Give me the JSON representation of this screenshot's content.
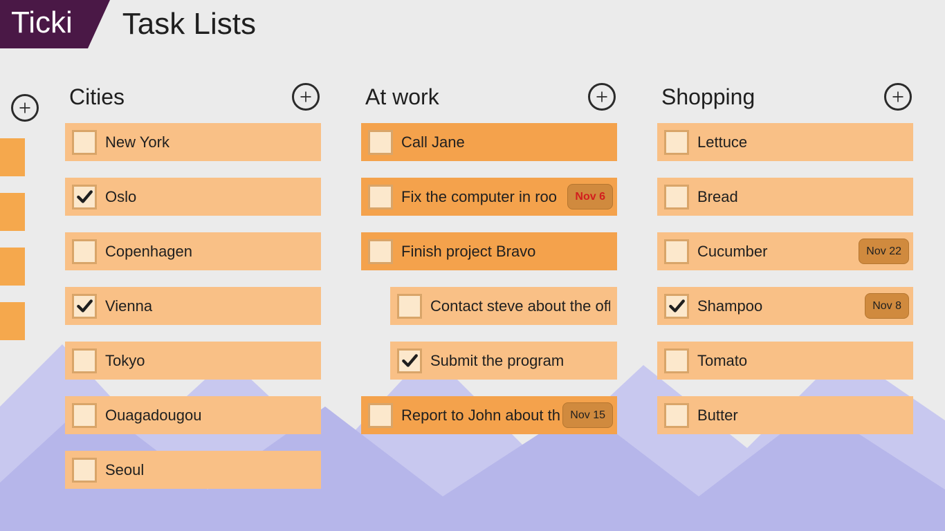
{
  "header": {
    "brand": "Ticki",
    "title": "Task Lists"
  },
  "columns": [
    {
      "title": "Cities",
      "items": [
        {
          "label": "New York",
          "checked": false,
          "dark": false
        },
        {
          "label": "Oslo",
          "checked": true,
          "dark": false
        },
        {
          "label": "Copenhagen",
          "checked": false,
          "dark": false
        },
        {
          "label": "Vienna",
          "checked": true,
          "dark": false
        },
        {
          "label": "Tokyo",
          "checked": false,
          "dark": false
        },
        {
          "label": "Ouagadougou",
          "checked": false,
          "dark": false
        },
        {
          "label": "Seoul",
          "checked": false,
          "dark": false
        }
      ]
    },
    {
      "title": "At work",
      "items": [
        {
          "label": "Call Jane",
          "checked": false,
          "dark": true
        },
        {
          "label": "Fix the computer in roo",
          "checked": false,
          "dark": true,
          "due": "Nov 6",
          "due_alert": true
        },
        {
          "label": "Finish project Bravo",
          "checked": false,
          "dark": true
        },
        {
          "label": "Contact steve about the off",
          "checked": false,
          "dark": false,
          "child": true
        },
        {
          "label": "Submit the program",
          "checked": true,
          "dark": false,
          "child": true
        },
        {
          "label": "Report to John about th",
          "checked": false,
          "dark": true,
          "due": "Nov 15"
        }
      ]
    },
    {
      "title": "Shopping",
      "items": [
        {
          "label": "Lettuce",
          "checked": false,
          "dark": false
        },
        {
          "label": "Bread",
          "checked": false,
          "dark": false
        },
        {
          "label": "Cucumber",
          "checked": false,
          "dark": false,
          "due": "Nov 22"
        },
        {
          "label": "Shampoo",
          "checked": true,
          "dark": false,
          "due": "Nov 8"
        },
        {
          "label": "Tomato",
          "checked": false,
          "dark": false
        },
        {
          "label": "Butter",
          "checked": false,
          "dark": false
        }
      ]
    }
  ]
}
